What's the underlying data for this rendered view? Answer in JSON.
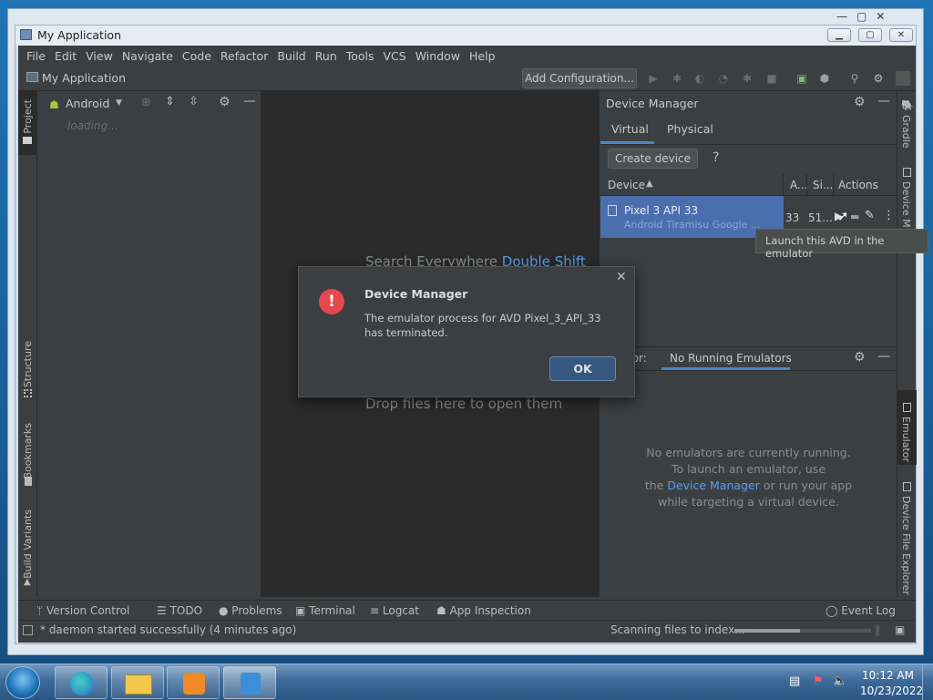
{
  "window": {
    "title": "My Application",
    "minimize": "▭",
    "maximize": "▢",
    "close": "✕"
  },
  "menu": [
    "File",
    "Edit",
    "View",
    "Navigate",
    "Code",
    "Refactor",
    "Build",
    "Run",
    "Tools",
    "VCS",
    "Window",
    "Help"
  ],
  "nav": {
    "project": "My Application",
    "add_configuration": "Add Configuration..."
  },
  "left_stripe": {
    "project": "Project",
    "structure": "Structure",
    "bookmarks": "Bookmarks",
    "build_variants": "Build Variants"
  },
  "project_panel": {
    "view": "Android",
    "loading": "loading..."
  },
  "editor": {
    "search_label": "Search Everywhere",
    "search_key": "Double Shift",
    "drop": "Drop files here to open them"
  },
  "device_manager": {
    "title": "Device Manager",
    "tabs": [
      "Virtual",
      "Physical"
    ],
    "create_device": "Create device",
    "help": "?",
    "columns": {
      "device": "Device",
      "api": "A...",
      "size": "Si...",
      "actions": "Actions"
    },
    "row": {
      "name": "Pixel 3 API 33",
      "subtitle": "Android Tiramisu Google ...",
      "api": "33",
      "size": "51..."
    }
  },
  "tooltip": "Launch this AVD in the emulator",
  "emulator": {
    "label": "tor:",
    "tab": "No Running Emulators",
    "line1": "No emulators are currently running.",
    "line2": "To launch an emulator, use",
    "line3_pre": "the",
    "line3_link": "Device Manager",
    "line3_post": "or run your app",
    "line4": "while targeting a virtual device."
  },
  "right_stripe": {
    "gradle": "Gradle",
    "device_manager": "Device M",
    "emulator": "Emulator",
    "file_explorer": "Device File Explorer"
  },
  "dialog": {
    "title": "Device Manager",
    "message": "The emulator process for AVD Pixel_3_API_33 has terminated.",
    "ok": "OK"
  },
  "bottom_tabs": [
    "Version Control",
    "TODO",
    "Problems",
    "Terminal",
    "Logcat",
    "App Inspection"
  ],
  "event_log": "Event Log",
  "status": {
    "message": "* daemon started successfully (4 minutes ago)",
    "indexing": "Scanning files to index..."
  },
  "taskbar": {
    "time": "10:12 AM",
    "date": "10/23/2022"
  },
  "colors": {
    "accent": "#4b6eaf",
    "link": "#589df6",
    "error": "#e5484d"
  }
}
